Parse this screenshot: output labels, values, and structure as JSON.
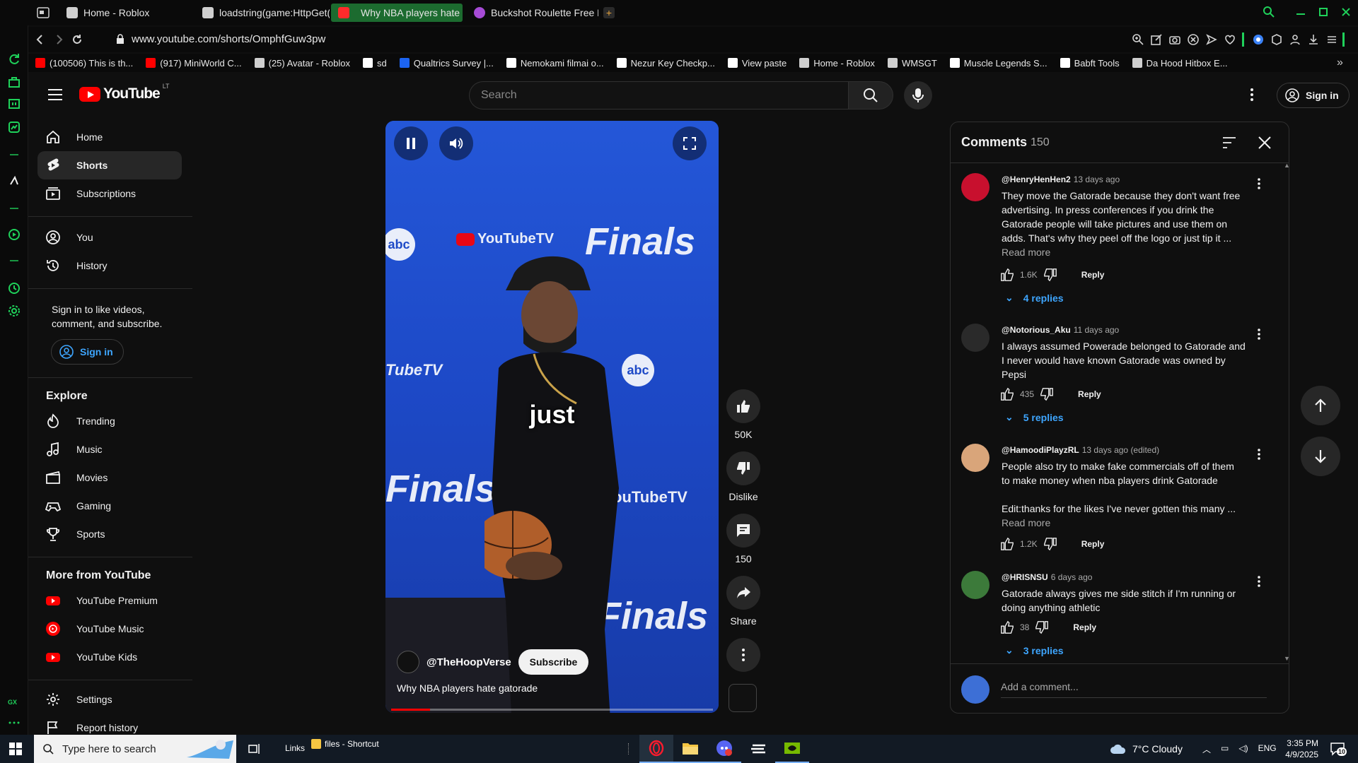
{
  "browser": {
    "tabs": [
      {
        "label": "Home - Roblox",
        "color": "#cfcfcf"
      },
      {
        "label": "loadstring(game:HttpGet(",
        "color": "#cfcfcf"
      },
      {
        "label": "Why NBA players hate",
        "color": "#ff2b2b"
      },
      {
        "label": "Buckshot Roulette Free D",
        "color": "#a64bd6"
      }
    ],
    "url": "www.youtube.com/shorts/OmphfGuw3pw",
    "bookmarks": [
      {
        "label": "(100506) This is th...",
        "color": "#ff0000"
      },
      {
        "label": "(917) MiniWorld C...",
        "color": "#ff0000"
      },
      {
        "label": "(25) Avatar - Roblox",
        "color": "#cfcfcf"
      },
      {
        "label": "sd",
        "color": "#ffffff"
      },
      {
        "label": "Qualtrics Survey |...",
        "color": "#1c64f2"
      },
      {
        "label": "Nemokami filmai o...",
        "color": "#ffffff"
      },
      {
        "label": "Nezur Key Checkp...",
        "color": "#ffffff"
      },
      {
        "label": "View paste",
        "color": "#ffffff"
      },
      {
        "label": "Home - Roblox",
        "color": "#cfcfcf"
      },
      {
        "label": "WMSGT",
        "color": "#cfcfcf"
      },
      {
        "label": "Muscle Legends S...",
        "color": "#ffffff"
      },
      {
        "label": "Babft Tools",
        "color": "#ffffff"
      },
      {
        "label": "Da Hood Hitbox E...",
        "color": "#cfcfcf"
      }
    ]
  },
  "header": {
    "logo_text": "YouTube",
    "logo_region": "LT",
    "search_placeholder": "Search",
    "sign_in": "Sign in"
  },
  "sidebar": {
    "main": [
      {
        "label": "Home",
        "icon": "home-icon"
      },
      {
        "label": "Shorts",
        "icon": "shorts-icon"
      },
      {
        "label": "Subscriptions",
        "icon": "subscriptions-icon"
      }
    ],
    "you": [
      {
        "label": "You",
        "icon": "you-icon"
      },
      {
        "label": "History",
        "icon": "history-icon"
      }
    ],
    "signin_prompt": "Sign in to like videos, comment, and subscribe.",
    "signin_button": "Sign in",
    "explore_heading": "Explore",
    "explore": [
      {
        "label": "Trending",
        "icon": "trending-icon"
      },
      {
        "label": "Music",
        "icon": "music-icon"
      },
      {
        "label": "Movies",
        "icon": "movies-icon"
      },
      {
        "label": "Gaming",
        "icon": "gaming-icon"
      },
      {
        "label": "Sports",
        "icon": "sports-icon"
      }
    ],
    "more_heading": "More from YouTube",
    "more": [
      {
        "label": "YouTube Premium",
        "icon": "youtube-premium-icon"
      },
      {
        "label": "YouTube Music",
        "icon": "youtube-music-icon"
      },
      {
        "label": "YouTube Kids",
        "icon": "youtube-kids-icon"
      }
    ],
    "settings": "Settings",
    "report": "Report history"
  },
  "video": {
    "caption": "just",
    "channel": "@TheHoopVerse",
    "subscribe": "Subscribe",
    "title": "Why NBA players hate gatorade",
    "progress": 0.12,
    "bg_text": {
      "abc": "abc",
      "youtubetv": "YouTubeTV",
      "finals": "Finals",
      "tubetv": "TubeTV"
    }
  },
  "actions": {
    "likes": "50K",
    "dislike": "Dislike",
    "comments": "150",
    "share": "Share"
  },
  "comments_panel": {
    "title": "Comments",
    "count": "150",
    "items": [
      {
        "author": "@HenryHenHen2",
        "time": "13 days ago",
        "lines": [
          "They move the Gatorade because they don't want free",
          "advertising. In press conferences if you drink the",
          "Gatorade people will take pictures and use them on",
          "adds. That's why they peel off the logo or just tip it ..."
        ],
        "read_more": "Read more",
        "likes": "1.6K",
        "reply": "Reply",
        "replies": "4 replies",
        "avatar_color": "#c8102e"
      },
      {
        "author": "@Notorious_Aku",
        "time": "11 days ago",
        "lines": [
          "I always assumed Powerade belonged to Gatorade and",
          "I never would have known Gatorade was owned by",
          "Pepsi"
        ],
        "likes": "435",
        "reply": "Reply",
        "replies": "5 replies",
        "avatar_color": "#2a2a2a"
      },
      {
        "author": "@HamoodiPlayzRL",
        "time": "13 days ago (edited)",
        "lines": [
          "People also try to make fake commercials off of them",
          "to make money when nba players drink Gatorade",
          "",
          "Edit:thanks for the likes I've never gotten this many ..."
        ],
        "read_more": "Read more",
        "likes": "1.2K",
        "reply": "Reply",
        "avatar_color": "#d9a57a"
      },
      {
        "author": "@HRISNSU",
        "time": "6 days ago",
        "lines": [
          "Gatorade always gives me side stitch if I'm running or",
          "doing anything athletic"
        ],
        "likes": "38",
        "reply": "Reply",
        "replies": "3 replies",
        "avatar_color": "#3c7a3a"
      }
    ],
    "add_placeholder": "Add a comment..."
  },
  "taskbar": {
    "search_placeholder": "Type here to search",
    "links": "Links",
    "files": "files - Shortcut",
    "weather": "7°C  Cloudy",
    "lang": "ENG",
    "time": "3:35 PM",
    "date": "4/9/2025",
    "notif_count": "10"
  },
  "colors": {
    "gx_accent": "#1fd15a",
    "yt_red": "#ff0000",
    "link_blue": "#3ea6ff"
  }
}
